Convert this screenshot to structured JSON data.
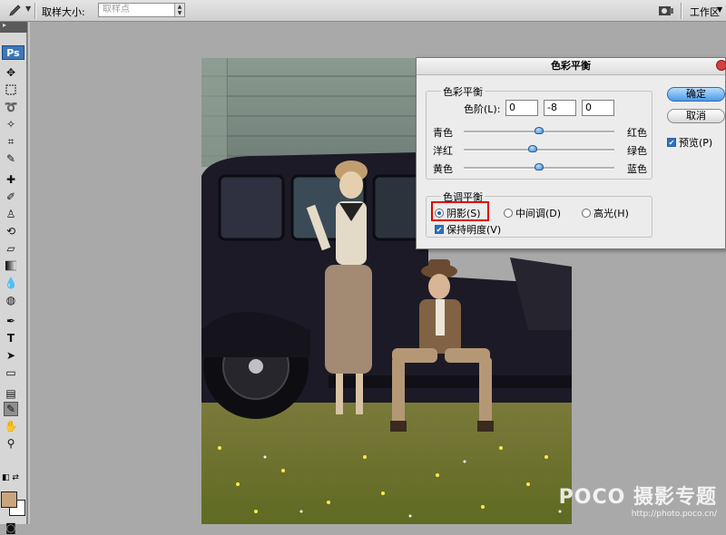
{
  "options_bar": {
    "sample_size_label": "取样大小:",
    "sample_size_value": "取样点",
    "workspace_label": "工作区"
  },
  "toolbox": {
    "logo": "Ps",
    "foreground_color": "#c9a57e",
    "background_color": "#ffffff",
    "tools": [
      "move-icon",
      "marquee-icon",
      "lasso-icon",
      "magic-wand-icon",
      "crop-icon",
      "eyedropper-icon",
      "healing-brush-icon",
      "brush-icon",
      "clone-stamp-icon",
      "history-brush-icon",
      "eraser-icon",
      "gradient-icon",
      "blur-icon",
      "dodge-icon",
      "pen-icon",
      "type-icon",
      "path-selection-icon",
      "shape-icon",
      "notes-icon",
      "color-sampler-icon",
      "hand-icon",
      "zoom-icon"
    ],
    "active_tool": "color-sampler-icon"
  },
  "dialog": {
    "title": "色彩平衡",
    "color_balance_legend": "色彩平衡",
    "levels_label": "色阶(L):",
    "levels": [
      "0",
      "-8",
      "0"
    ],
    "sliders": [
      {
        "left": "青色",
        "right": "红色",
        "value": 0
      },
      {
        "left": "洋红",
        "right": "绿色",
        "value": -8
      },
      {
        "left": "黄色",
        "right": "蓝色",
        "value": 0
      }
    ],
    "tone_balance_legend": "色调平衡",
    "tones": [
      {
        "label": "阴影(S)",
        "selected": true
      },
      {
        "label": "中间调(D)",
        "selected": false
      },
      {
        "label": "高光(H)",
        "selected": false
      }
    ],
    "preserve_luminosity": {
      "label": "保持明度(V)",
      "checked": true
    },
    "ok_label": "确定",
    "cancel_label": "取消",
    "preview": {
      "label": "预览(P)",
      "checked": true
    }
  },
  "watermark": {
    "brand": "POCO 摄影专题",
    "url": "http://photo.poco.cn/"
  }
}
